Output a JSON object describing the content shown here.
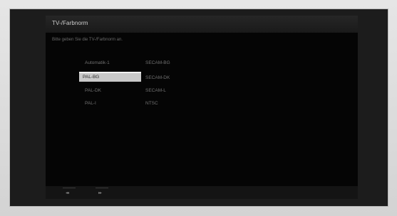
{
  "dialog": {
    "title": "TV-/Farbnorm",
    "instruction": "Bitte geben Sie die TV-/Farbnorm an."
  },
  "options": {
    "left": [
      {
        "label": "Automatik-1",
        "selected": false
      },
      {
        "label": "PAL-BG",
        "selected": true
      },
      {
        "label": "PAL-DK",
        "selected": false
      },
      {
        "label": "PAL-I",
        "selected": false
      }
    ],
    "right": [
      {
        "label": "SECAM-BG",
        "selected": false
      },
      {
        "label": "SECAM-DK",
        "selected": false
      },
      {
        "label": "SECAM-L",
        "selected": false
      },
      {
        "label": "NTSC",
        "selected": false
      }
    ]
  },
  "footer": {
    "back_glyph": "◂◂",
    "forward_glyph": "▸▸"
  },
  "colors": {
    "panel_background": "#050505",
    "selection_background": "#c9c9c9",
    "text": "#727272"
  }
}
